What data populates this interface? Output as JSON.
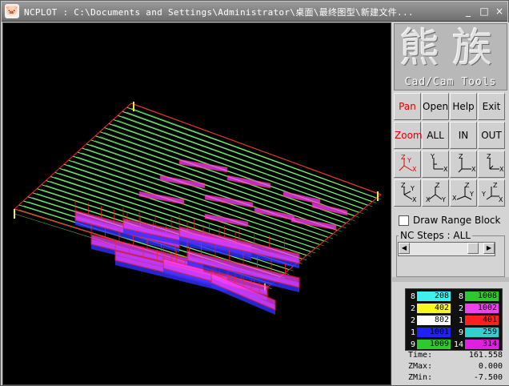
{
  "window": {
    "title": "NCPLOT : C:\\Documents and Settings\\Administrator\\桌面\\最终图型\\新建文件..."
  },
  "titlebar": {
    "app_icon": "pig-icon",
    "minimize": "_",
    "maximize": "□",
    "close": "×"
  },
  "logo": {
    "char1": "熊",
    "char2": "族",
    "subtitle": "Cad/Cam Tools"
  },
  "toolbar": {
    "pan": "Pan",
    "open": "Open",
    "help": "Help",
    "exit": "Exit",
    "zoom": "Zoom",
    "all": "ALL",
    "in": "IN",
    "out": "OUT"
  },
  "view_buttons": [
    "view-iso-zyx-icon",
    "view-front-zx-icon",
    "view-side-zx-icon",
    "view-top-zx-icon",
    "view-iso-zxy-icon",
    "view-iso-xyz-icon",
    "view-xy-z-icon",
    "view-yz-x-icon"
  ],
  "options": {
    "draw_range_block": "Draw Range Block",
    "draw_range_checked": false
  },
  "nc_steps": {
    "label": "NC Steps : ALL",
    "position": 0.92
  },
  "legend": [
    {
      "tool_l": "8",
      "val_l": "208",
      "color_l": "#40f0f0",
      "tool_r": "8",
      "val_r": "1008",
      "color_r": "#30c830"
    },
    {
      "tool_l": "2",
      "val_l": "402",
      "color_l": "#f8f820",
      "tool_r": "2",
      "val_r": "1002",
      "color_r": "#f040f0"
    },
    {
      "tool_l": "2",
      "val_l": "802",
      "color_l": "#ffffff",
      "tool_r": "1",
      "val_r": "401",
      "color_r": "#ff2020"
    },
    {
      "tool_l": "1",
      "val_l": "1001",
      "color_l": "#2020ff",
      "tool_r": "9",
      "val_r": "259",
      "color_r": "#30d0d0"
    },
    {
      "tool_l": "9",
      "val_l": "1009",
      "color_l": "#30c830",
      "tool_r": "14",
      "val_r": "314",
      "color_r": "#e020e0"
    }
  ],
  "readouts": {
    "time_label": "Time:",
    "time": "161.558",
    "zmax_label": "ZMax:",
    "zmax": "0.000",
    "zmin_label": "ZMin:",
    "zmin": "-7.500"
  },
  "colors": {
    "path_green": "#80ff80",
    "rapid_red": "#ff2020",
    "cut_magenta": "#ff40ff",
    "cut_blue": "#3030ff",
    "marker_yellow": "#f0f040"
  }
}
